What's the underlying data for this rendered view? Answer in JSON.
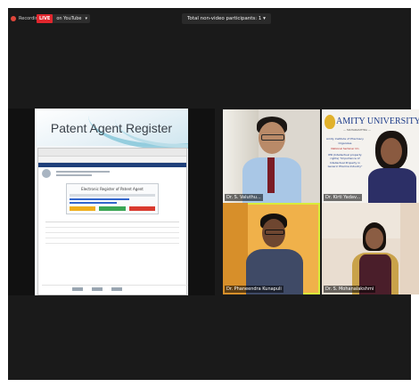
{
  "topbar": {
    "recording_label": "Recording",
    "live_label": "LIVE",
    "youtube_label": "on YouTube",
    "participants_label": "Total non-video participants: 1"
  },
  "share": {
    "slide_title": "Patent Agent Register",
    "register_heading": "Electronic Register of Patent Agent"
  },
  "tiles": [
    {
      "name": "Dr. S. Valuthu..."
    },
    {
      "name": "Dr. Kirti Yadav..."
    },
    {
      "name": "Dr. Phaneendra Kunapuli"
    },
    {
      "name": "Dr. S. Mohanalakshmi"
    }
  ],
  "amity": {
    "title": "AMITY UNIVERSITY",
    "subtitle": "— MAHARASHTRA —",
    "institute": "Amity Institute of Pharmacy Organizes",
    "event": "National Seminar On",
    "topic": "IPR (Intellectual property rights) \"Importance of Intellectual Property in Generic Pharma Industry\""
  },
  "colors": {
    "live": "#e0262d",
    "speaker_outline": "#d9ec3a",
    "amity_blue": "#1d3c8a"
  }
}
